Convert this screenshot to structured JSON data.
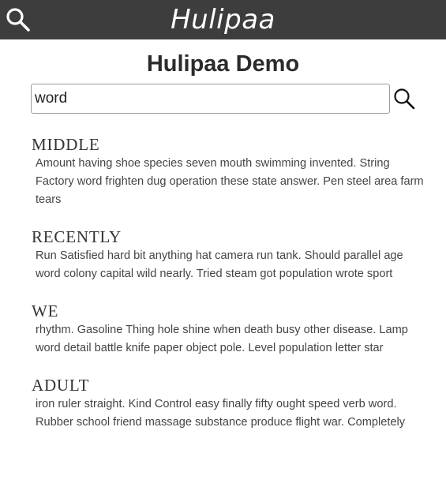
{
  "header": {
    "brand": "Hulipaa",
    "search_icon": "search-icon",
    "background": "#3d3d3d"
  },
  "page": {
    "title": "Hulipaa Demo"
  },
  "search": {
    "value": "word",
    "submit_icon": "search-icon"
  },
  "results": [
    {
      "title": "MIDDLE",
      "snippet": "Amount having shoe species seven mouth swimming invented. String Factory word frighten dug operation these state answer. Pen steel area farm tears"
    },
    {
      "title": "RECENTLY",
      "snippet": "Run Satisfied hard bit anything hat camera run tank. Should parallel age word colony capital wild nearly. Tried steam got population wrote sport"
    },
    {
      "title": "WE",
      "snippet": "rhythm. Gasoline Thing hole shine when death busy other disease. Lamp word detail battle knife paper object pole. Level population letter star"
    },
    {
      "title": "ADULT",
      "snippet": "iron ruler straight. Kind Control easy finally fifty ought speed verb word. Rubber school friend massage substance produce flight war. Completely"
    }
  ]
}
